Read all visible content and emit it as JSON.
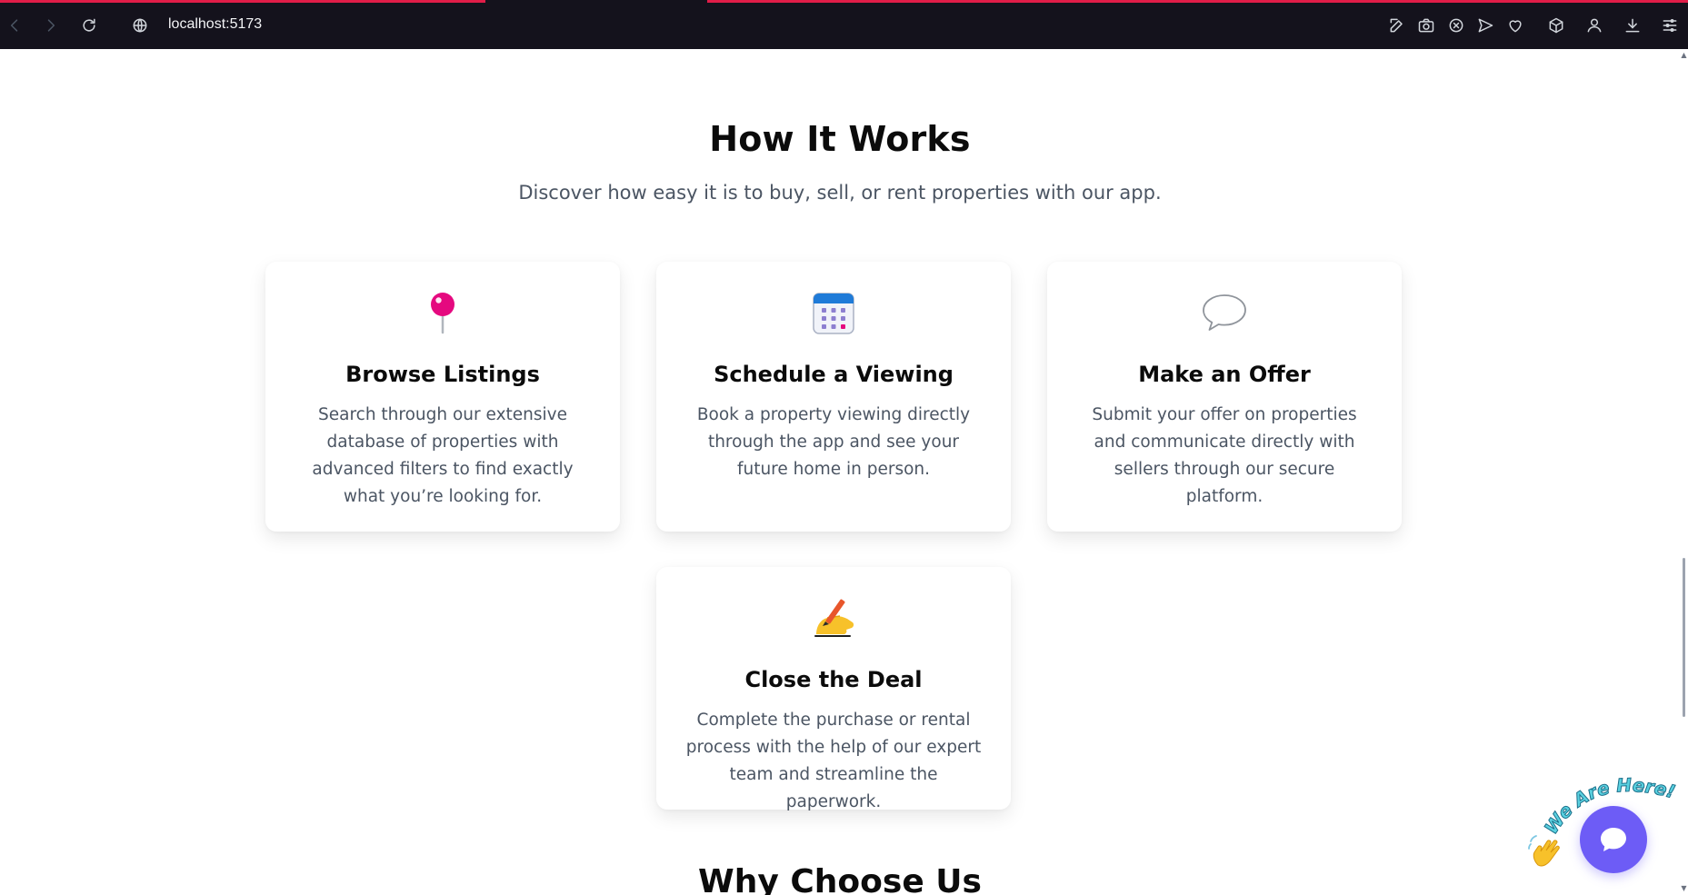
{
  "browser": {
    "url": "localhost:5173"
  },
  "section": {
    "title": "How It Works",
    "subtitle": "Discover how easy it is to buy, sell, or rent properties with our app."
  },
  "steps": [
    {
      "icon": "pushpin-icon",
      "title": "Browse Listings",
      "description": "Search through our extensive database of properties with advanced filters to find exactly what you’re looking for."
    },
    {
      "icon": "calendar-icon",
      "title": "Schedule a Viewing",
      "description": "Book a property viewing directly through the app and see your future home in person."
    },
    {
      "icon": "speech-bubble-icon",
      "title": "Make an Offer",
      "description": "Submit your offer on properties and communicate directly with sellers through our secure platform."
    },
    {
      "icon": "writing-hand-icon",
      "title": "Close the Deal",
      "description": "Complete the purchase or rental process with the help of our expert team and streamline the paperwork."
    }
  ],
  "next_section": {
    "title": "Why Choose Us"
  },
  "chat_widget": {
    "tagline": "We Are Here!",
    "accent": "#6d5cf6"
  },
  "colors": {
    "chrome_bg": "#14121c",
    "pin": "#e5097f",
    "text_muted": "#4b5563"
  }
}
